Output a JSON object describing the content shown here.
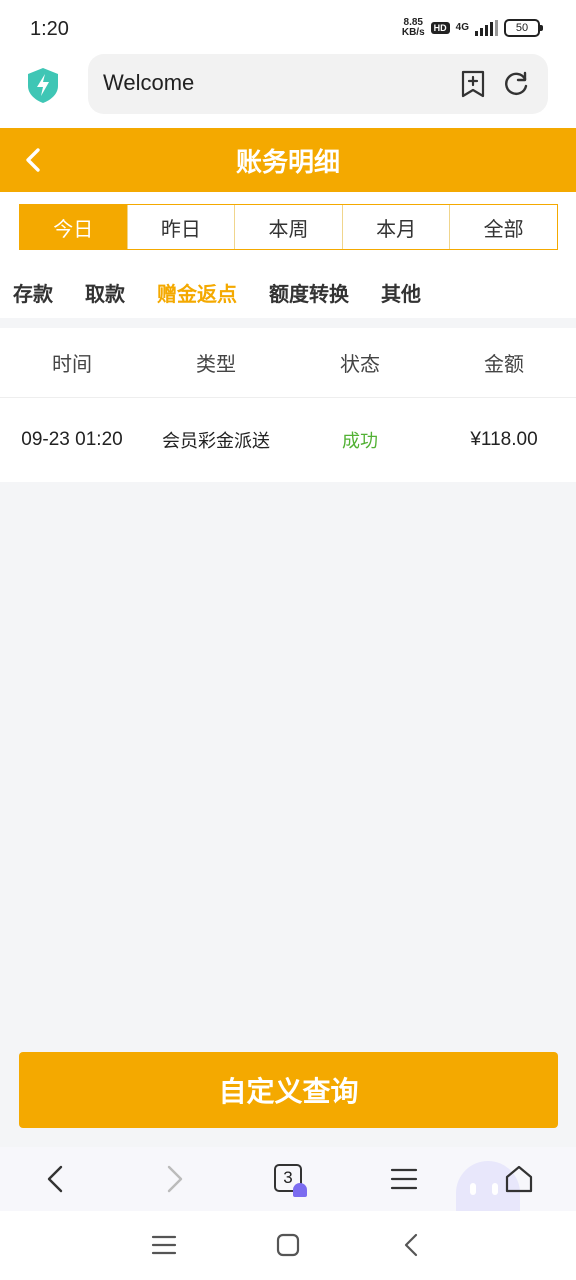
{
  "status_bar": {
    "time": "1:20",
    "speed_value": "8.85",
    "speed_unit": "KB/s",
    "hd_badge": "HD",
    "network": "4G",
    "battery": "50"
  },
  "browser": {
    "url_text": "Welcome",
    "tab_count": "3"
  },
  "header": {
    "title": "账务明细"
  },
  "period_tabs": [
    {
      "label": "今日",
      "active": true
    },
    {
      "label": "昨日",
      "active": false
    },
    {
      "label": "本周",
      "active": false
    },
    {
      "label": "本月",
      "active": false
    },
    {
      "label": "全部",
      "active": false
    }
  ],
  "category_tabs": [
    {
      "label": "存款",
      "active": false
    },
    {
      "label": "取款",
      "active": false
    },
    {
      "label": "赠金返点",
      "active": true
    },
    {
      "label": "额度转换",
      "active": false
    },
    {
      "label": "其他",
      "active": false
    }
  ],
  "table": {
    "columns": [
      "时间",
      "类型",
      "状态",
      "金额"
    ],
    "rows": [
      {
        "time": "09-23 01:20",
        "type": "会员彩金派送",
        "status": "成功",
        "amount": "¥118.00"
      }
    ]
  },
  "query_button": "自定义查询",
  "colors": {
    "accent": "#f4a900",
    "success": "#52b134",
    "background": "#f4f5f7"
  },
  "icons": [
    "shield-bolt-icon",
    "bookmark-add-icon",
    "refresh-icon",
    "chevron-left-icon",
    "back-arrow-icon",
    "forward-arrow-icon",
    "tabs-icon",
    "menu-icon",
    "home-icon",
    "ghost-icon"
  ]
}
